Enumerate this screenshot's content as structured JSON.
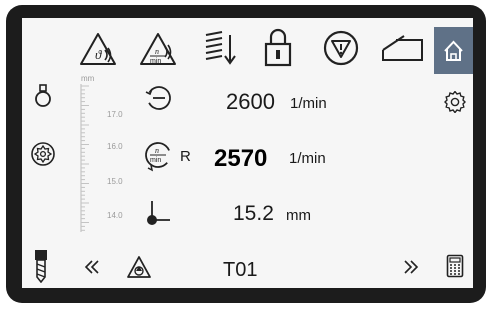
{
  "top_bar": {
    "icons": [
      "theta-feed-warning-icon",
      "rpm-warning-icon",
      "spring-down-icon",
      "padlock-icon",
      "stop-circle-icon",
      "door-open-icon"
    ],
    "home_icon": "home-icon"
  },
  "left_bar": {
    "icons": [
      "spindle-icon",
      "gear-circle-icon",
      "drill-bit-icon"
    ]
  },
  "right_bar": {
    "icons": [
      "settings-gear-icon",
      "calculator-icon"
    ]
  },
  "scale": {
    "unit": "mm",
    "labels": [
      "17.0",
      "16.0",
      "15.0",
      "14.0"
    ]
  },
  "spindle_set": {
    "icon": "rotation-arrow-icon",
    "value": "2600",
    "unit": "1/min"
  },
  "spindle_actual": {
    "icon_text": "n",
    "icon_subtext": "min",
    "label": "R",
    "value": "2570",
    "unit": "1/min"
  },
  "position": {
    "icon": "position-axis-icon",
    "value": "15.2",
    "unit": "mm"
  },
  "bottom_bar": {
    "prev_icon": "double-chevron-left-icon",
    "tool_icon": "tool-warning-icon",
    "tool": "T01",
    "next_icon": "double-chevron-right-icon"
  }
}
